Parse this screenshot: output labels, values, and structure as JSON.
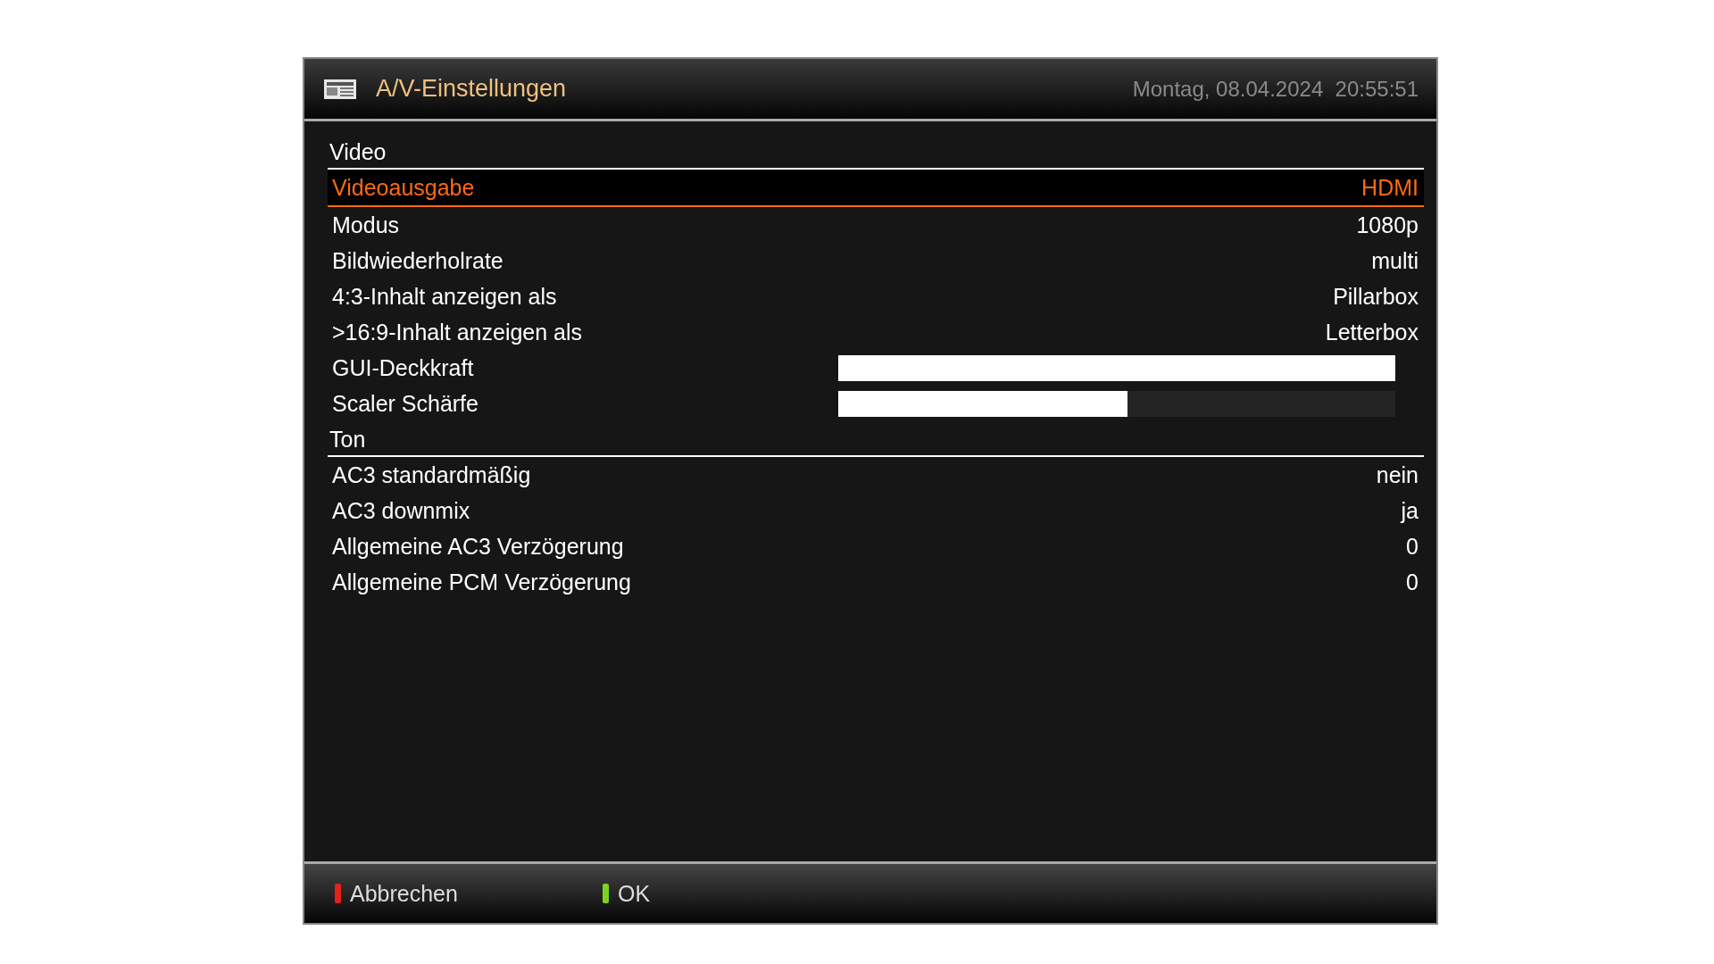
{
  "header": {
    "title": "A/V-Einstellungen",
    "datetime": "Montag, 08.04.2024  20:55:51"
  },
  "sections": [
    {
      "title": "Video",
      "items": [
        {
          "kind": "value",
          "label": "Videoausgabe",
          "value": "HDMI",
          "selected": true
        },
        {
          "kind": "value",
          "label": "Modus",
          "value": "1080p",
          "selected": false
        },
        {
          "kind": "value",
          "label": "Bildwiederholrate",
          "value": "multi",
          "selected": false
        },
        {
          "kind": "value",
          "label": "4:3-Inhalt anzeigen als",
          "value": "Pillarbox",
          "selected": false
        },
        {
          "kind": "value",
          "label": ">16:9-Inhalt anzeigen als",
          "value": "Letterbox",
          "selected": false
        },
        {
          "kind": "slider",
          "label": "GUI-Deckkraft",
          "level": 1.0,
          "selected": false
        },
        {
          "kind": "slider",
          "label": "Scaler Schärfe",
          "level": 0.52,
          "selected": false
        }
      ]
    },
    {
      "title": "Ton",
      "items": [
        {
          "kind": "value",
          "label": "AC3 standardmäßig",
          "value": "nein",
          "selected": false
        },
        {
          "kind": "value",
          "label": "AC3 downmix",
          "value": "ja",
          "selected": false
        },
        {
          "kind": "value",
          "label": "Allgemeine AC3 Verzögerung",
          "value": "0",
          "selected": false
        },
        {
          "kind": "value",
          "label": "Allgemeine PCM Verzögerung",
          "value": "0",
          "selected": false
        }
      ]
    }
  ],
  "buttons": [
    {
      "label": "Abbrechen",
      "color": "#e8201c"
    },
    {
      "label": "OK",
      "color": "#7ed321"
    }
  ]
}
